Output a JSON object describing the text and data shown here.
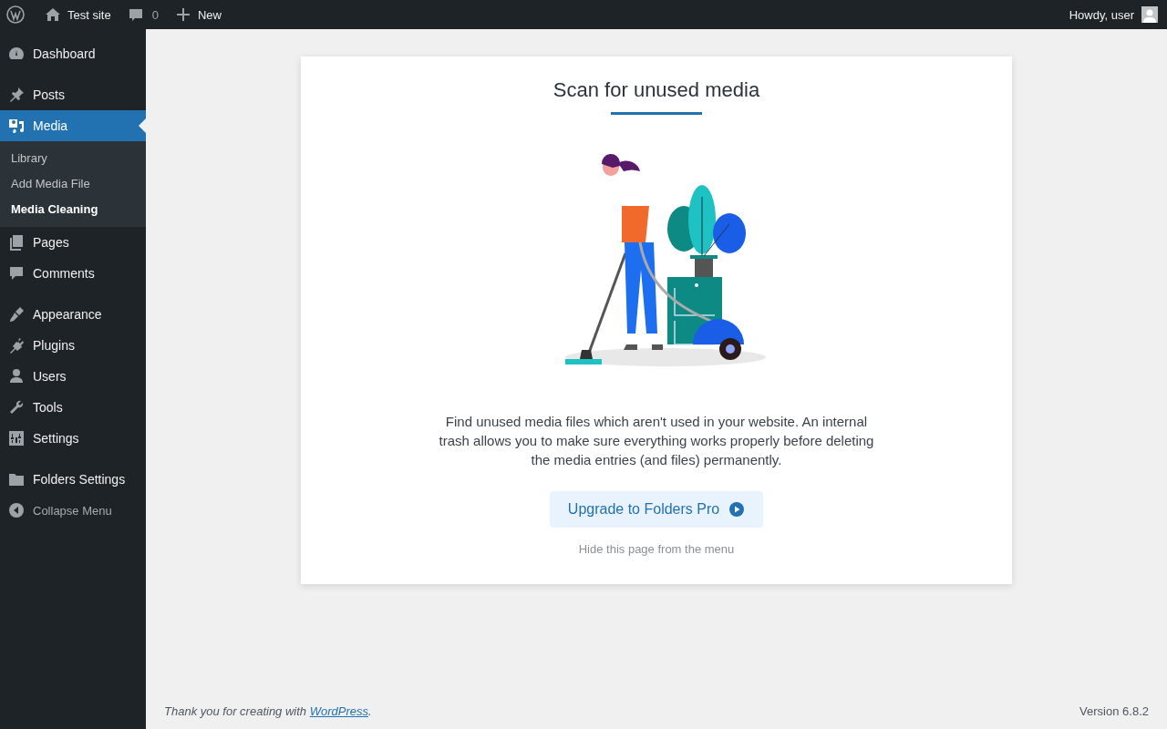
{
  "admin_bar": {
    "site": "Test site",
    "comments": "0",
    "new": "New",
    "greeting": "Howdy, user"
  },
  "sidebar": {
    "groups": [
      [
        {
          "label": "Dashboard",
          "selected": false
        }
      ],
      [
        {
          "label": "Posts",
          "selected": false
        },
        {
          "label": "Media",
          "selected": true,
          "children": [
            {
              "label": "Library",
              "selected": false
            },
            {
              "label": "Add Media File",
              "selected": false
            },
            {
              "label": "Media Cleaning",
              "selected": true
            }
          ]
        },
        {
          "label": "Pages",
          "selected": false
        },
        {
          "label": "Comments",
          "selected": false
        }
      ],
      [
        {
          "label": "Appearance",
          "selected": false
        },
        {
          "label": "Plugins",
          "selected": false
        },
        {
          "label": "Users",
          "selected": false
        },
        {
          "label": "Tools",
          "selected": false
        },
        {
          "label": "Settings",
          "selected": false
        }
      ],
      [
        {
          "label": "Folders Settings",
          "selected": false
        }
      ]
    ],
    "collapse": "Collapse Menu"
  },
  "card": {
    "title": "Scan for unused media",
    "description": "Find unused media files which aren't used in your website. An internal trash allows you to make sure everything works properly before deleting the media entries (and files) permanently.",
    "button": "Upgrade to Folders Pro",
    "hide_link": "Hide this page from the menu"
  },
  "footer": {
    "thanks": "Thank you for creating with ",
    "link": "WordPress",
    "after": ".",
    "version": "Version 6.8.2"
  }
}
